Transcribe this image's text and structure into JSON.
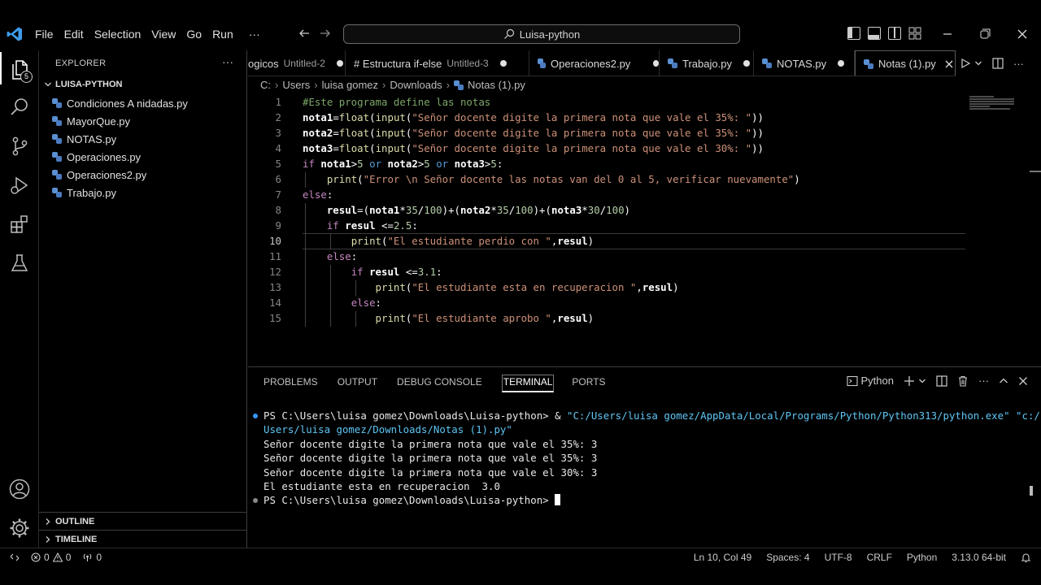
{
  "menu": [
    "File",
    "Edit",
    "Selection",
    "View",
    "Go",
    "Run",
    "···"
  ],
  "search": {
    "text": "Luisa-python"
  },
  "activity": {
    "explorer_badge": "5"
  },
  "sidebar": {
    "title": "EXPLORER",
    "folder": "LUISA-PYTHON",
    "files": [
      "Condiciones A nidadas.py",
      "MayorQue.py",
      "NOTAS.py",
      "Operaciones.py",
      "Operaciones2.py",
      "Trabajo.py"
    ],
    "outline": "OUTLINE",
    "timeline": "TIMELINE"
  },
  "tabs": [
    {
      "name": "ogicos",
      "desc": "Untitled-2",
      "dirty": true
    },
    {
      "name": "# Estructura if-else",
      "desc": "Untitled-3",
      "dirty": true
    },
    {
      "name": "Operaciones2.py",
      "desc": "",
      "dirty": true
    },
    {
      "name": "Trabajo.py",
      "desc": "",
      "dirty": true
    },
    {
      "name": "NOTAS.py",
      "desc": "",
      "dirty": true
    },
    {
      "name": "Notas (1).py",
      "desc": "",
      "active": true
    }
  ],
  "breadcrumb": [
    "C:",
    "Users",
    "luisa gomez",
    "Downloads",
    "Notas (1).py"
  ],
  "editor": {
    "current_line": 10,
    "lines": [
      "#Este programa define las notas",
      "nota1=float(input(\"Señor docente digite la primera nota que vale el 35%: \"))",
      "nota2=float(input(\"Señor docente digite la primera nota que vale el 35%: \"))",
      "nota3=float(input(\"Señor docente digite la primera nota que vale el 30%: \"))",
      "if nota1>5 or nota2>5 or nota3>5:",
      "    print(\"Error \\n Señor docente las notas van del 0 al 5, verificar nuevamente\")",
      "else:",
      "    resul=(nota1*35/100)+(nota2*35/100)+(nota3*30/100)",
      "    if resul <=2.5:",
      "        print(\"El estudiante perdio con \",resul)",
      "    else:",
      "        if resul <=3.1:",
      "            print(\"El estudiante esta en recuperacion \",resul)",
      "        else:",
      "            print(\"El estudiante aprobo \",resul)"
    ]
  },
  "panel": {
    "tabs": [
      "PROBLEMS",
      "OUTPUT",
      "DEBUG CONSOLE",
      "TERMINAL",
      "PORTS"
    ],
    "active_tab": "TERMINAL",
    "shell": "Python",
    "terminal": [
      {
        "prompt": "PS C:\\Users\\luisa gomez\\Downloads\\Luisa-python> & ",
        "cmd": "\"C:/Users/luisa gomez/AppData/Local/Programs/Python/Python313/python.exe\" \"c:/",
        "dot": "#3794ff"
      },
      {
        "text": "Users/luisa gomez/Downloads/Notas (1).py\"",
        "cmdcolor": true
      },
      {
        "text": "Señor docente digite la primera nota que vale el 35%: 3"
      },
      {
        "text": "Señor docente digite la primera nota que vale el 35%: 3"
      },
      {
        "text": "Señor docente digite la primera nota que vale el 30%: 3"
      },
      {
        "text": "El estudiante esta en recuperacion  3.0"
      },
      {
        "prompt": "PS C:\\Users\\luisa gomez\\Downloads\\Luisa-python> ",
        "dot": "#8a8a8a",
        "cursor": true
      }
    ]
  },
  "status": {
    "errors": "0",
    "warnings": "0",
    "ports": "0",
    "position": "Ln 10, Col 49",
    "spaces": "Spaces: 4",
    "encoding": "UTF-8",
    "eol": "CRLF",
    "language": "Python",
    "interpreter": "3.13.0 64-bit"
  }
}
